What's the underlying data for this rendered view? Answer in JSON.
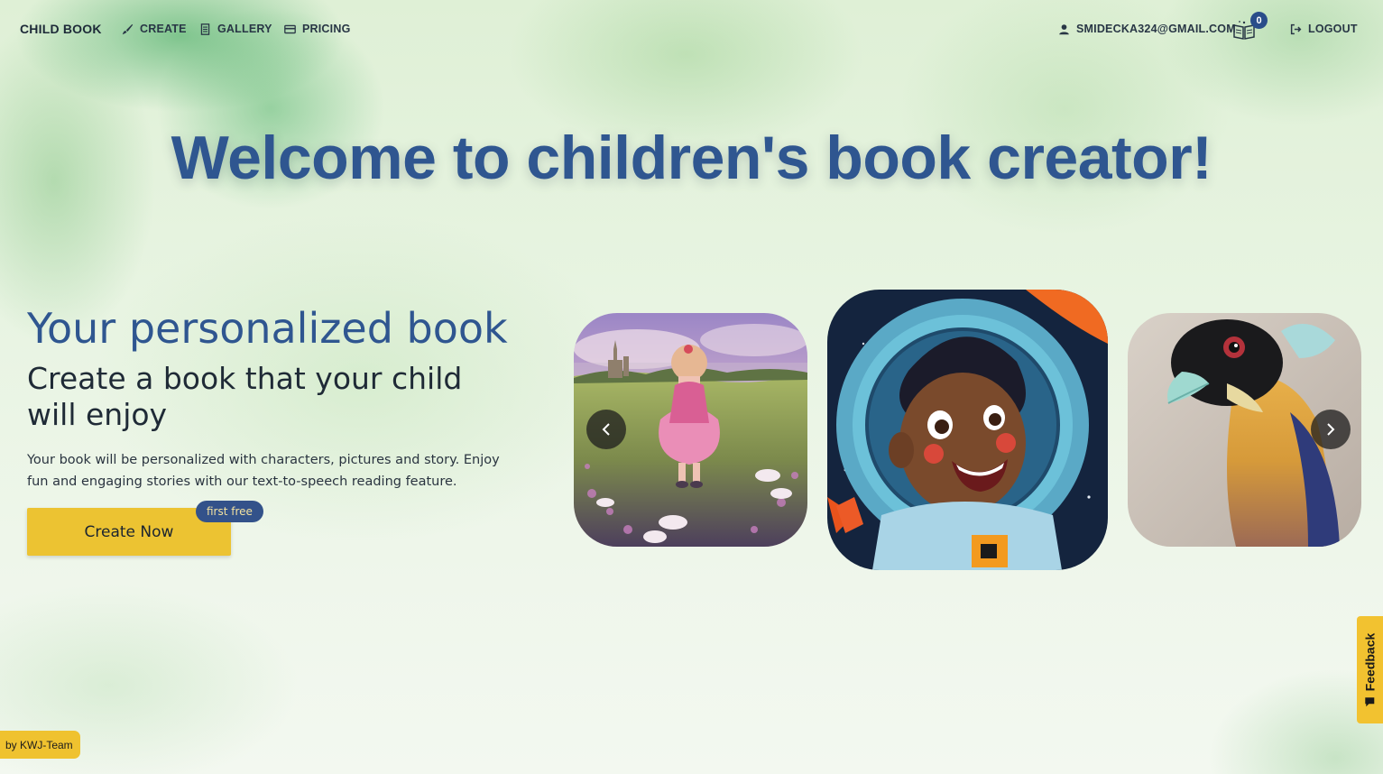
{
  "nav": {
    "brand": "CHILD BOOK",
    "links": {
      "create": "CREATE",
      "gallery": "GALLERY",
      "pricing": "PRICING"
    },
    "user_email": "SMIDECKA324@GMAIL.COM",
    "cart_count": "0",
    "logout": "LOGOUT"
  },
  "hero": {
    "title": "Welcome to children's book creator!",
    "subtitle": "Your personalized book",
    "tagline": "Create a book that your child will enjoy",
    "description": "Your book will be personalized with characters, pictures and story. Enjoy fun and engaging stories with our text-to-speech reading feature.",
    "cta_label": "Create Now",
    "cta_badge": "first free"
  },
  "carousel": {
    "slides": [
      "girl-in-flower-field-illustration",
      "boy-astronaut-illustration",
      "exotic-bird-illustration"
    ],
    "prev_icon": "chevron-left-icon",
    "next_icon": "chevron-right-icon"
  },
  "feedback": {
    "label": "Feedback"
  },
  "footer": {
    "credit": "by KWJ-Team"
  },
  "colors": {
    "title_blue": "#2f5690",
    "cta_yellow": "#ecc332",
    "badge_blue": "#33528a"
  }
}
